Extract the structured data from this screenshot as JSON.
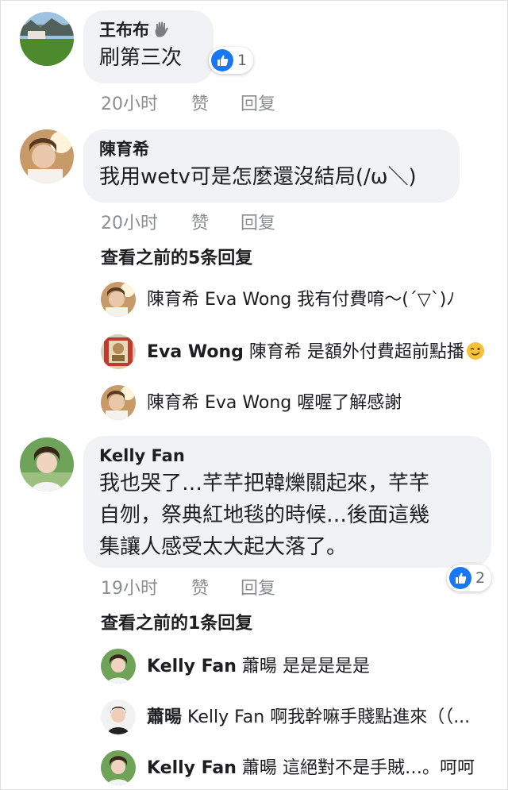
{
  "colors": {
    "bubble_bg": "#f0f2f5",
    "meta_text": "#8a8d91",
    "like_blue": "#1877f2"
  },
  "comments": [
    {
      "name": "王布布",
      "name_icon": "waving-hand-icon",
      "text": "刷第三次",
      "time": "20小时",
      "like_label": "赞",
      "reply_label": "回复",
      "reaction_count": "1"
    },
    {
      "name": "陳育希",
      "text": "我用wetv可是怎麼還沒結局(/ω＼)",
      "time": "20小时",
      "like_label": "赞",
      "reply_label": "回复",
      "view_previous": "查看之前的5条回复",
      "replies": [
        {
          "name": "陳育希",
          "tag": "Eva Wong",
          "text": "我有付費唷～(´▽`)ﾉ"
        },
        {
          "name": "Eva Wong",
          "tag": "陳育希",
          "text": "是額外付費超前點播",
          "emoji": "winking-face-icon"
        },
        {
          "name": "陳育希",
          "tag": "Eva Wong",
          "text": "喔喔了解感謝"
        }
      ]
    },
    {
      "name": "Kelly Fan",
      "text_lines": [
        "我也哭了…芊芊把韓爍關起來，芊芊",
        "自刎，祭典紅地毯的時候…後面這幾",
        "集讓人感受太大起大落了。"
      ],
      "time": "19小时",
      "like_label": "赞",
      "reply_label": "回复",
      "reaction_count": "2",
      "view_previous": "查看之前的1条回复",
      "replies": [
        {
          "name": "Kelly Fan",
          "tag": "蕭暘",
          "text": "是是是是是"
        },
        {
          "name": "蕭暘",
          "tag": "Kelly Fan",
          "text": "啊我幹嘛手賤點進來（（..."
        },
        {
          "name": "Kelly Fan",
          "tag": "蕭暘",
          "text": "這絕對不是手賊…。呵呵"
        }
      ]
    }
  ]
}
